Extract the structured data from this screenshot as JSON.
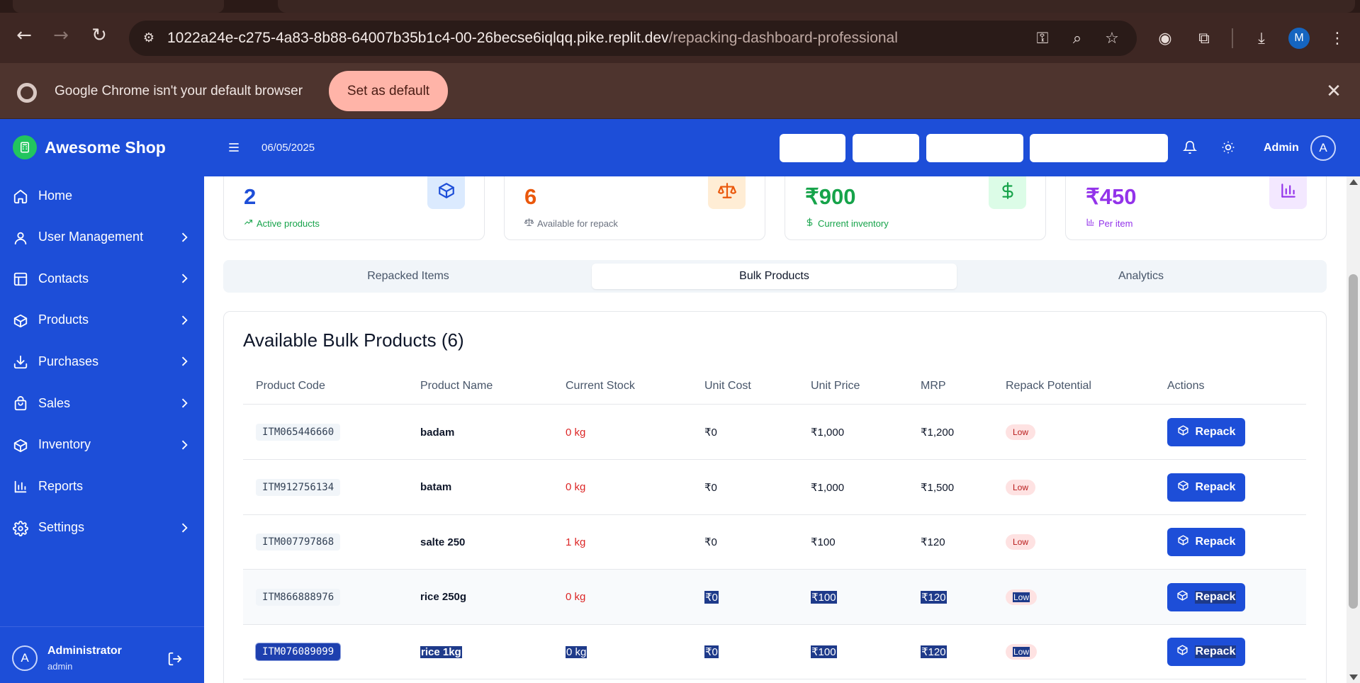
{
  "browser": {
    "url_host": "1022a24e-c275-4a83-8b88-64007b35b1c4-00-26becse6iqlqq.pike.replit.dev",
    "url_path": "/repacking-dashboard-professional",
    "profile_initial": "M",
    "infobar_message": "Google Chrome isn't your default browser",
    "set_default_label": "Set as default"
  },
  "sidebar": {
    "brand": "Awesome Shop",
    "items": [
      {
        "label": "Home",
        "icon": "home-icon",
        "has_submenu": false
      },
      {
        "label": "User Management",
        "icon": "user-icon",
        "has_submenu": true
      },
      {
        "label": "Contacts",
        "icon": "contacts-icon",
        "has_submenu": true
      },
      {
        "label": "Products",
        "icon": "box-icon",
        "has_submenu": true
      },
      {
        "label": "Purchases",
        "icon": "download-icon",
        "has_submenu": true
      },
      {
        "label": "Sales",
        "icon": "shopping-bag-icon",
        "has_submenu": true
      },
      {
        "label": "Inventory",
        "icon": "box-icon",
        "has_submenu": true
      },
      {
        "label": "Reports",
        "icon": "bar-chart-icon",
        "has_submenu": false
      },
      {
        "label": "Settings",
        "icon": "gear-icon",
        "has_submenu": true
      }
    ],
    "user": {
      "initial": "A",
      "name": "Administrator",
      "role": "admin"
    }
  },
  "header": {
    "date": "06/05/2025",
    "user_label": "Admin",
    "user_initial": "A"
  },
  "stats": [
    {
      "value": "2",
      "sub": "Active products",
      "color": "#1d4ed8",
      "sub_color": "#16a34a",
      "badge_bg": "#dbeafe",
      "icon": "box-icon"
    },
    {
      "value": "6",
      "sub": "Available for repack",
      "color": "#ea580c",
      "sub_color": "#6b7280",
      "badge_bg": "#ffedd5",
      "icon": "scale-icon"
    },
    {
      "value": "₹900",
      "sub": "Current inventory",
      "color": "#16a34a",
      "sub_color": "#16a34a",
      "badge_bg": "#dcfce7",
      "icon": "dollar-icon"
    },
    {
      "value": "₹450",
      "sub": "Per item",
      "color": "#9333ea",
      "sub_color": "#9333ea",
      "badge_bg": "#f3e8ff",
      "icon": "bar-chart-icon"
    }
  ],
  "tabs": [
    {
      "label": "Repacked Items",
      "active": false
    },
    {
      "label": "Bulk Products",
      "active": true
    },
    {
      "label": "Analytics",
      "active": false
    }
  ],
  "panel": {
    "title": "Available Bulk Products (6)",
    "columns": [
      "Product Code",
      "Product Name",
      "Current Stock",
      "Unit Cost",
      "Unit Price",
      "MRP",
      "Repack Potential",
      "Actions"
    ],
    "rows": [
      {
        "code": "ITM065446660",
        "name": "badam",
        "stock": "0 kg",
        "cost": "₹0",
        "price": "₹1,000",
        "mrp": "₹1,200",
        "potential": "Low",
        "action": "Repack"
      },
      {
        "code": "ITM912756134",
        "name": "batam",
        "stock": "0 kg",
        "cost": "₹0",
        "price": "₹1,000",
        "mrp": "₹1,500",
        "potential": "Low",
        "action": "Repack"
      },
      {
        "code": "ITM007797868",
        "name": "salte 250",
        "stock": "1 kg",
        "cost": "₹0",
        "price": "₹100",
        "mrp": "₹120",
        "potential": "Low",
        "action": "Repack"
      },
      {
        "code": "ITM866888976",
        "name": "rice 250g",
        "stock": "0 kg",
        "cost": "₹0",
        "price": "₹100",
        "mrp": "₹120",
        "potential": "Low",
        "action": "Repack"
      },
      {
        "code": "ITM076089099",
        "name": "rice 1kg",
        "stock": "0 kg",
        "cost": "₹0",
        "price": "₹100",
        "mrp": "₹120",
        "potential": "Low",
        "action": "Repack"
      }
    ]
  }
}
